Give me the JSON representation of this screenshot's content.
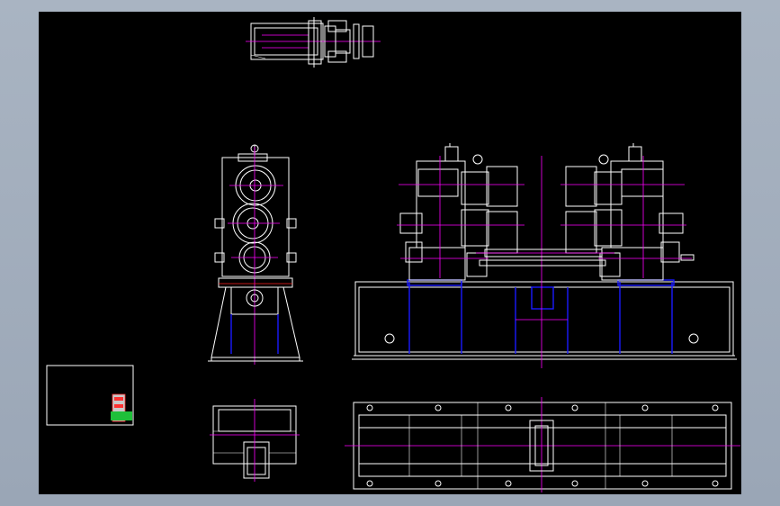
{
  "colors": {
    "frame": "#a9b4c2",
    "sheet": "#000000",
    "outline": "#ffffff",
    "centerline": "#ff00ff",
    "hidden": "#1a1aff",
    "accent": "#ff2020"
  }
}
